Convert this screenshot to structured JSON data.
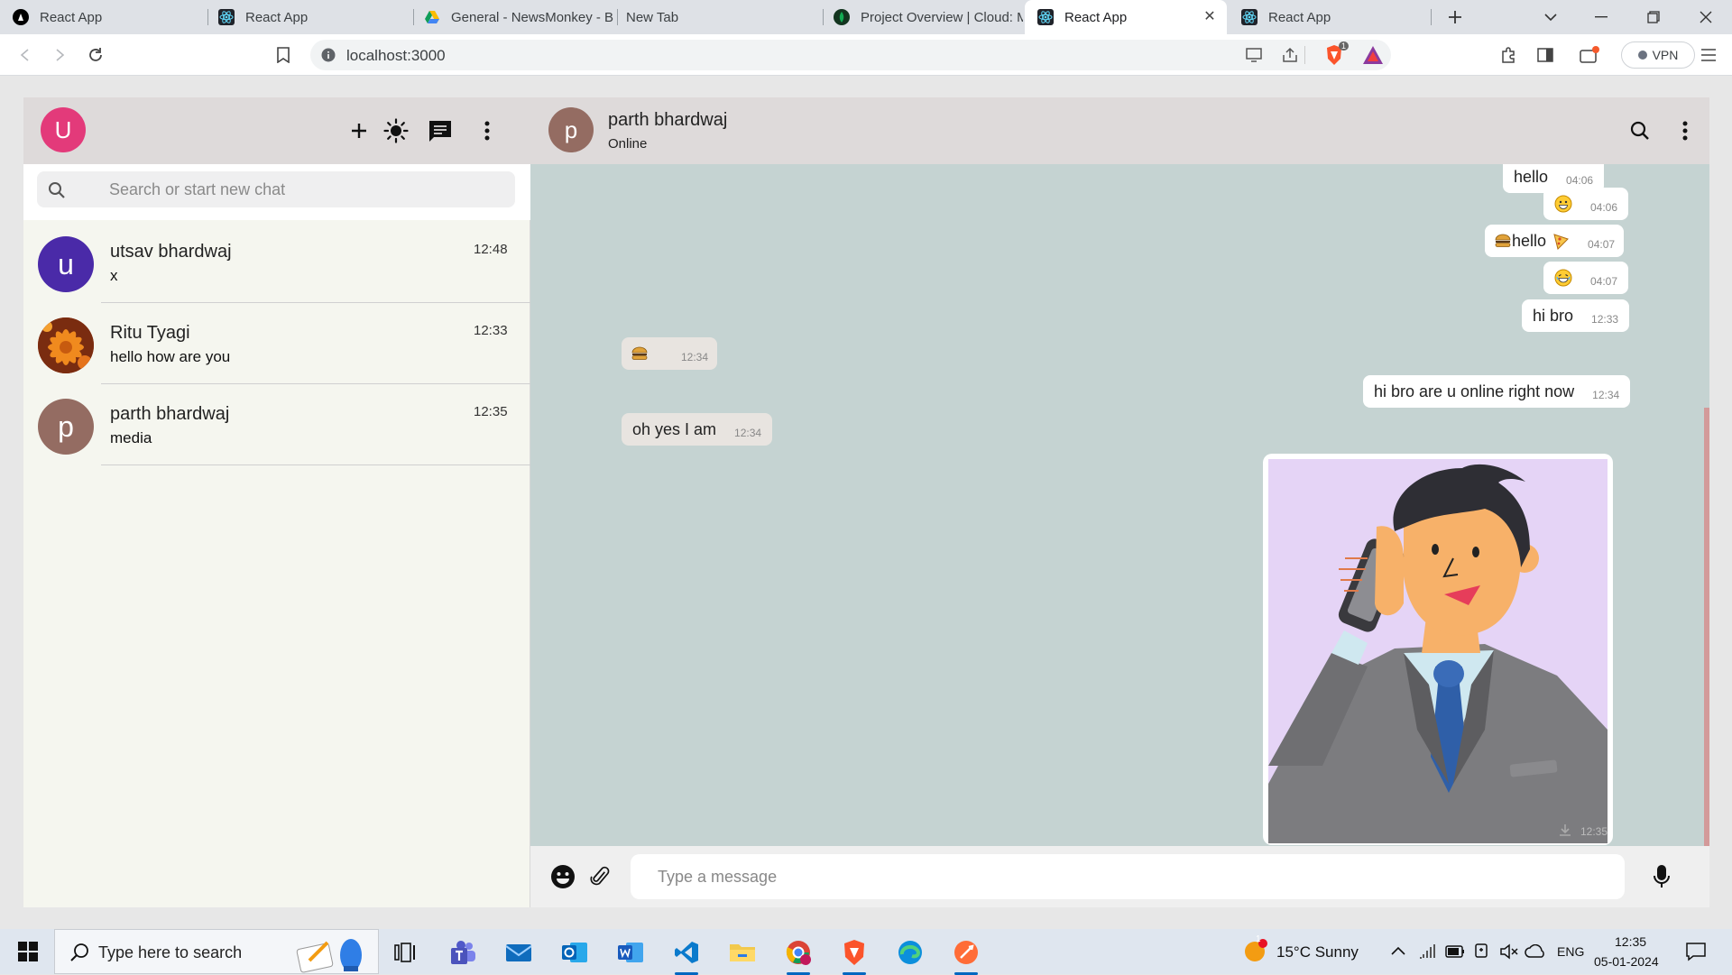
{
  "browser": {
    "tabs": [
      {
        "title": "React App"
      },
      {
        "title": "React App"
      },
      {
        "title": "General - NewsMonkey - B"
      },
      {
        "title": "New Tab"
      },
      {
        "title": "Project Overview | Cloud: M"
      },
      {
        "title": "React App"
      },
      {
        "title": "React App"
      }
    ],
    "url": "localhost:3000",
    "vpn_label": "VPN",
    "shields_count": "1"
  },
  "sidebar": {
    "profile_initial": "U",
    "search_placeholder": "Search or start new chat",
    "chats": [
      {
        "initial": "u",
        "name": "utsav bhardwaj",
        "preview": "x",
        "time": "12:48",
        "avatar_color": "#4a2aa8"
      },
      {
        "initial": "",
        "name": "Ritu Tyagi",
        "preview": "hello how are you",
        "time": "12:33",
        "avatar_color": "#e9641c"
      },
      {
        "initial": "p",
        "name": "parth bhardwaj",
        "preview": "media",
        "time": "12:35",
        "avatar_color": "#946c62"
      }
    ]
  },
  "conversation": {
    "contact_initial": "p",
    "contact_name": "parth bhardwaj",
    "contact_status": "Online",
    "composer_placeholder": "Type a message",
    "messages": [
      {
        "dir": "out",
        "text": "hello",
        "time": "04:06"
      },
      {
        "dir": "out",
        "text": "",
        "emoji": "grin",
        "time": "04:06"
      },
      {
        "dir": "out",
        "text": "hello",
        "emoji": "burger+pizza",
        "time": "04:07"
      },
      {
        "dir": "out",
        "text": "",
        "emoji": "laugh",
        "time": "04:07"
      },
      {
        "dir": "out",
        "text": "hi bro",
        "time": "12:33"
      },
      {
        "dir": "in",
        "text": "",
        "emoji": "burger",
        "time": "12:34"
      },
      {
        "dir": "out",
        "text": "hi bro are u online right now",
        "time": "12:34"
      },
      {
        "dir": "in",
        "text": "oh yes I am",
        "time": "12:34"
      },
      {
        "dir": "out",
        "type": "image",
        "image": "cartoon man in a suit talking on a phone",
        "time": "12:35"
      }
    ]
  },
  "taskbar": {
    "search_placeholder": "Type here to search",
    "weather": "15°C  Sunny",
    "language": "ENG",
    "clock_time": "12:35",
    "clock_date": "05-01-2024",
    "notification_count": "1"
  },
  "colors": {
    "profile_avatar": "#e33a7a",
    "chat_background": "#c5d3d2",
    "header_background": "#dedada"
  }
}
